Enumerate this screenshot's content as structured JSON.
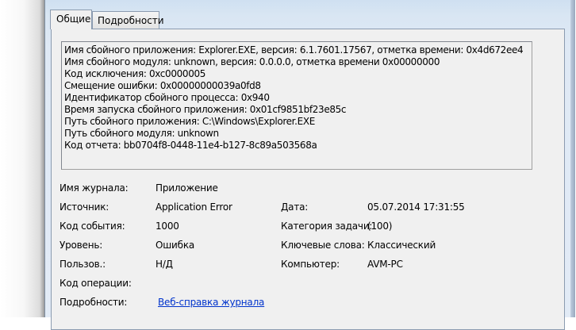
{
  "tabs": [
    {
      "label": "Общие"
    },
    {
      "label": "Подробности"
    }
  ],
  "description": [
    "Имя сбойного приложения: Explorer.EXE, версия: 6.1.7601.17567, отметка времени: 0x4d672ee4",
    "Имя сбойного модуля: unknown, версия: 0.0.0.0, отметка времени 0x00000000",
    "Код исключения: 0xc0000005",
    "Смещение ошибки: 0x00000000039a0fd8",
    "Идентификатор сбойного процесса: 0x940",
    "Время запуска сбойного приложения: 0x01cf9851bf23e85c",
    "Путь сбойного приложения: C:\\Windows\\Explorer.EXE",
    "Путь сбойного модуля: unknown",
    "Код отчета: bb0704f8-0448-11e4-b127-8c89a503568a"
  ],
  "fields": {
    "log_name": {
      "label": "Имя журнала:",
      "value": "Приложение"
    },
    "source": {
      "label": "Источник:",
      "value": "Application Error"
    },
    "date": {
      "label": "Дата:",
      "value": "05.07.2014 17:31:55"
    },
    "event_id": {
      "label": "Код события:",
      "value": "1000"
    },
    "task_category": {
      "label": "Категория задачи:",
      "value": "(100)"
    },
    "level": {
      "label": "Уровень:",
      "value": "Ошибка"
    },
    "keywords": {
      "label": "Ключевые слова:",
      "value": "Классический"
    },
    "user": {
      "label": "Пользов.:",
      "value": "Н/Д"
    },
    "computer": {
      "label": "Компьютер:",
      "value": "AVM-PC"
    },
    "opcode": {
      "label": "Код операции:",
      "value": ""
    },
    "more_info": {
      "label": "Подробности:",
      "link": "Веб-справка журнала "
    }
  }
}
